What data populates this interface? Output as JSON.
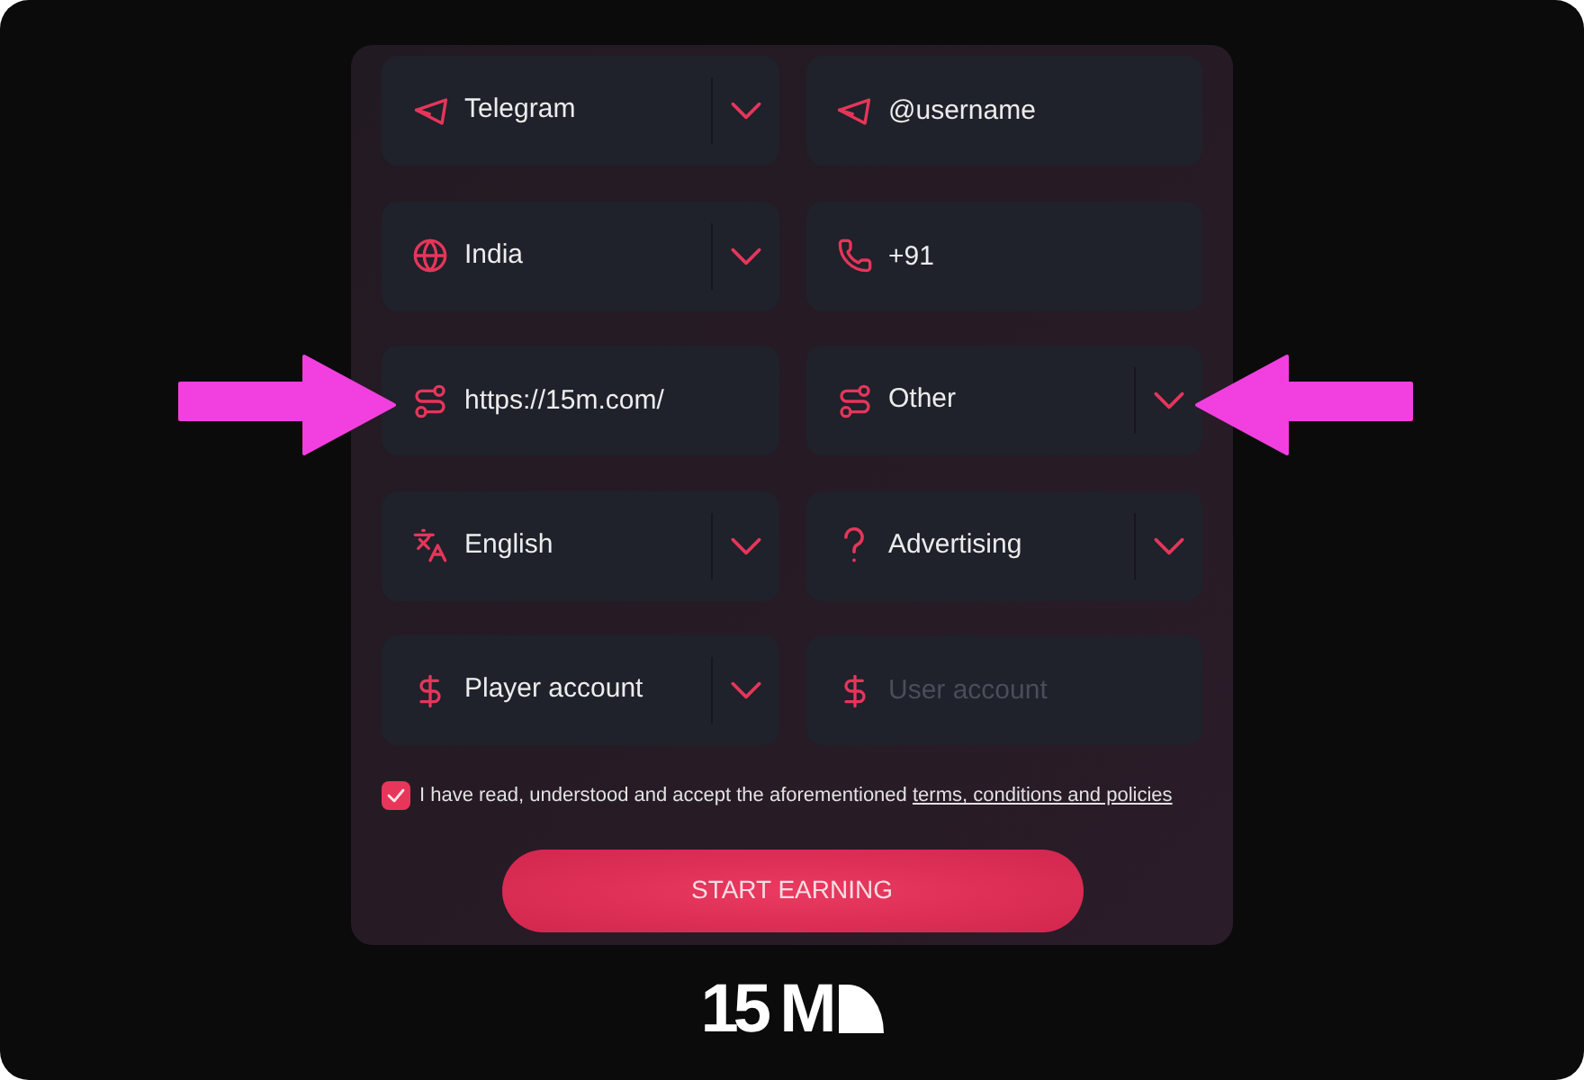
{
  "form": {
    "fields": [
      {
        "kind": "select",
        "value": "Telegram"
      },
      {
        "kind": "input",
        "value": "@username"
      },
      {
        "kind": "select",
        "value": "India"
      },
      {
        "kind": "input",
        "value": "+91"
      },
      {
        "kind": "input",
        "value": "https://15m.com/"
      },
      {
        "kind": "select",
        "value": "Other"
      },
      {
        "kind": "select",
        "value": "English"
      },
      {
        "kind": "select",
        "value": "Advertising"
      },
      {
        "kind": "select",
        "value": "Player account"
      },
      {
        "kind": "input",
        "placeholder": "User account"
      }
    ],
    "agreement": {
      "checked": true,
      "text": "I have read, understood and accept the aforementioned",
      "link": "terms, conditions and policies"
    },
    "submit_button": {
      "label": "START EARNING"
    }
  },
  "logo": {
    "text": "15 M"
  }
}
